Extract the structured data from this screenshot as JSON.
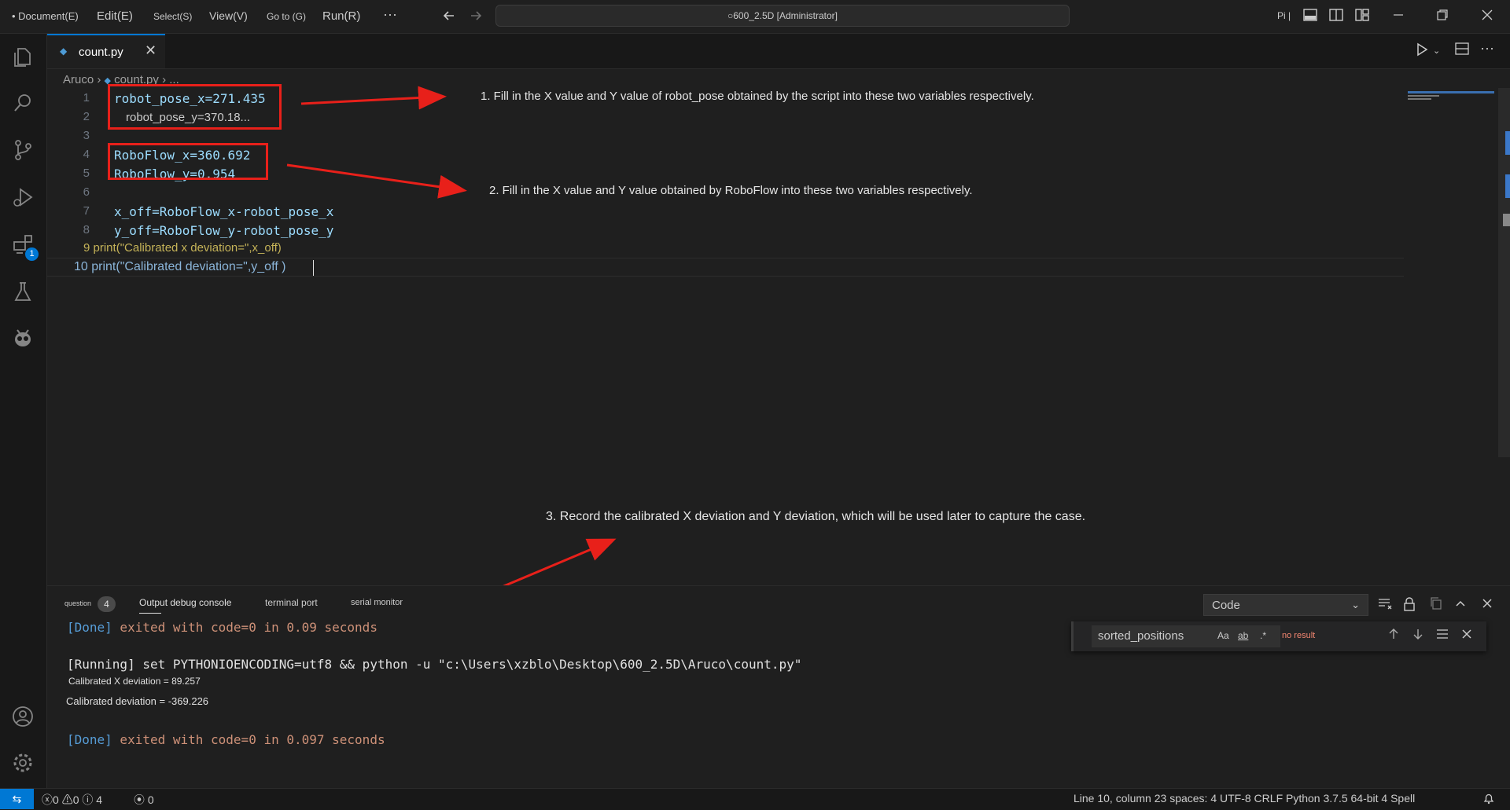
{
  "menu": {
    "document": "• Document(E)",
    "edit": "Edit(E)",
    "select": "Select(S)",
    "view": "View(V)",
    "goto": "Go to (G)",
    "run": "Run(R)",
    "more": "···"
  },
  "command_center": "○600_2.5D [Administrator]",
  "title_extra": "Pi |",
  "tab": {
    "filename": "count.py"
  },
  "breadcrumb": {
    "folder": "Aruco",
    "file": "count.py",
    "more": "..."
  },
  "editor": {
    "lines": [
      {
        "n": "1",
        "text": "robot_pose_x=271.435"
      },
      {
        "n": "2",
        "text": "robot_pose_y=370.18..."
      },
      {
        "n": "3",
        "text": ""
      },
      {
        "n": "4",
        "text": "RoboFlow_x=360.692"
      },
      {
        "n": "5",
        "text": "RoboFlow_y=0.954"
      },
      {
        "n": "6",
        "text": ""
      },
      {
        "n": "7",
        "text": "x_off=RoboFlow_x-robot_pose_x"
      },
      {
        "n": "8",
        "text": "y_off=RoboFlow_y-robot_pose_y"
      },
      {
        "n": "9",
        "text": "print(\"Calibrated x deviation=\",x_off)"
      },
      {
        "n": "10",
        "text": "print(\"Calibrated deviation=\",y_off )"
      }
    ]
  },
  "annotations": {
    "a1": "1. Fill in the X value and Y value of robot_pose obtained by the script into these two variables respectively.",
    "a2": "2. Fill in the X value and Y value obtained by RoboFlow into these two variables respectively.",
    "a3": "3. Record the calibrated X deviation and Y deviation, which will be used later to capture the case."
  },
  "panel": {
    "tabs": {
      "question": "question",
      "question_count": "4",
      "output": "Output debug console",
      "terminal": "terminal port",
      "serial": "serial monitor"
    },
    "select_value": "Code",
    "find": {
      "value": "sorted_positions",
      "case": "Aa",
      "word": "ab",
      "regex": ".*",
      "result": "no result"
    },
    "output": {
      "done1_tag": "[Done]",
      "done1_text": " exited with code=0 in 0.09 seconds",
      "running": "[Running] set PYTHONIOENCODING=utf8 && python -u \"c:\\Users\\xzblo\\Desktop\\600_2.5D\\Aruco\\count.py\"",
      "calib_x": "Calibrated X deviation = 89.257",
      "calib_y": "Calibrated deviation = -369.226",
      "done2_tag": "[Done]",
      "done2_text": " exited with code=0 in 0.097 seconds"
    }
  },
  "status": {
    "errors": "0",
    "warnings": "0",
    "infos": "4",
    "ports": "0",
    "right": "Line 10, column 23 spaces: 4 UTF-8 CRLF Python 3.7.5 64-bit 4 Spell"
  },
  "colors": {
    "accent": "#0078d4",
    "highlight_box": "#e8201a",
    "arrow": "#e8201a"
  }
}
